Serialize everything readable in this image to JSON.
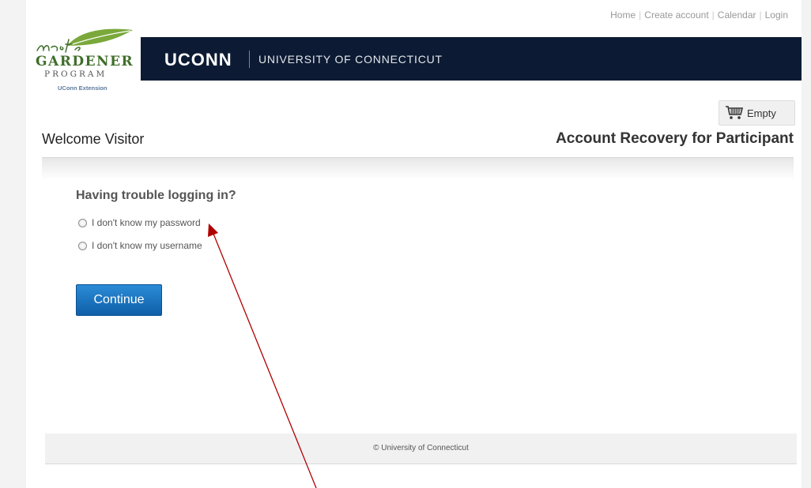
{
  "top_nav": {
    "home": "Home",
    "create_account": "Create account",
    "calendar": "Calendar",
    "login": "Login"
  },
  "logo": {
    "script_word": "master",
    "gardener": "GARDENER",
    "program": "PROGRAM",
    "extension": "UConn Extension"
  },
  "banner": {
    "wordmark": "UCONN",
    "university": "UNIVERSITY OF CONNECTICUT"
  },
  "cart": {
    "icon": "shopping-cart-icon",
    "label": "Empty"
  },
  "header": {
    "welcome": "Welcome Visitor",
    "page_title": "Account Recovery for Participant"
  },
  "recovery": {
    "question": "Having trouble logging in?",
    "options": [
      {
        "label": "I don't know my password",
        "selected": false
      },
      {
        "label": "I don't know my username",
        "selected": false
      }
    ],
    "continue_label": "Continue"
  },
  "footer": {
    "copyright": "© University of Connecticut"
  },
  "colors": {
    "banner": "#0c1b33",
    "button": "#1a6fbd",
    "logo_green": "#3f6e2a",
    "annotation_arrow": "#b00000"
  }
}
